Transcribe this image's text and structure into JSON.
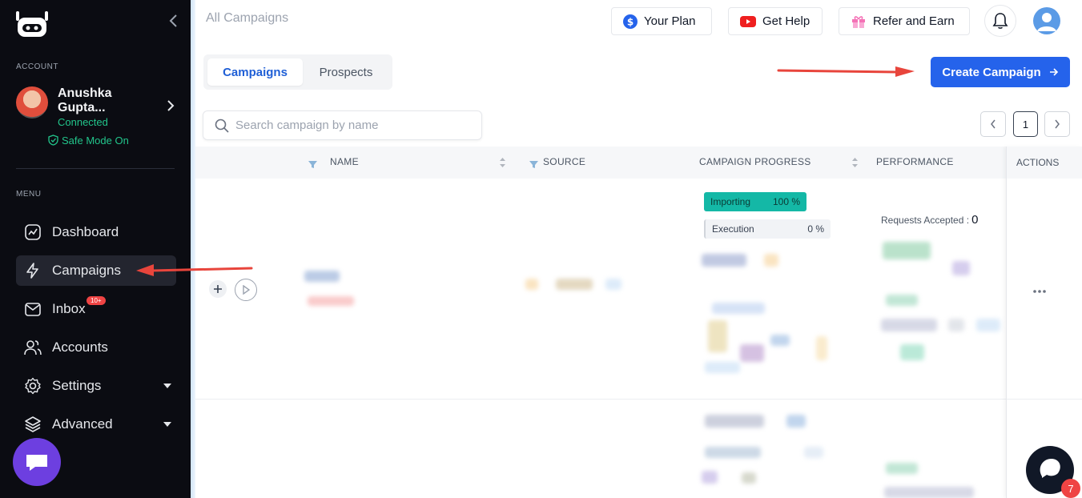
{
  "page_title": "All Campaigns",
  "header": {
    "your_plan": "Your Plan",
    "get_help": "Get Help",
    "refer_earn": "Refer and Earn"
  },
  "sidebar": {
    "account_label": "ACCOUNT",
    "account_name": "Anushka Gupta...",
    "account_status": "Connected",
    "safe_mode": "Safe Mode On",
    "menu_label": "MENU",
    "items": [
      {
        "label": "Dashboard",
        "icon": "dashboard-icon"
      },
      {
        "label": "Campaigns",
        "icon": "lightning-icon",
        "active": true
      },
      {
        "label": "Inbox",
        "icon": "inbox-icon",
        "badge": "10+"
      },
      {
        "label": "Accounts",
        "icon": "users-icon"
      },
      {
        "label": "Settings",
        "icon": "gear-icon"
      },
      {
        "label": "Advanced",
        "icon": "layers-icon"
      }
    ]
  },
  "tabs": [
    {
      "label": "Campaigns",
      "active": true
    },
    {
      "label": "Prospects",
      "active": false
    }
  ],
  "create_button": "Create Campaign",
  "search": {
    "placeholder": "Search campaign by name"
  },
  "pagination": {
    "current": "1"
  },
  "table": {
    "headers": {
      "name": "NAME",
      "source": "SOURCE",
      "progress": "CAMPAIGN PROGRESS",
      "performance": "PERFORMANCE",
      "actions": "ACTIONS"
    },
    "row": {
      "importing_label": "Importing",
      "importing_value": "100 %",
      "importing_fraction": 1.0,
      "execution_label": "Execution",
      "execution_value": "0 %",
      "execution_fraction": 0.0,
      "requests_label": "Requests Accepted :",
      "requests_value": "0"
    }
  },
  "help_badge": "7",
  "colors": {
    "sidebar_bg": "#0b0c12",
    "accent": "#2563eb",
    "connected": "#22c58b",
    "importing": "#14b8a6"
  }
}
